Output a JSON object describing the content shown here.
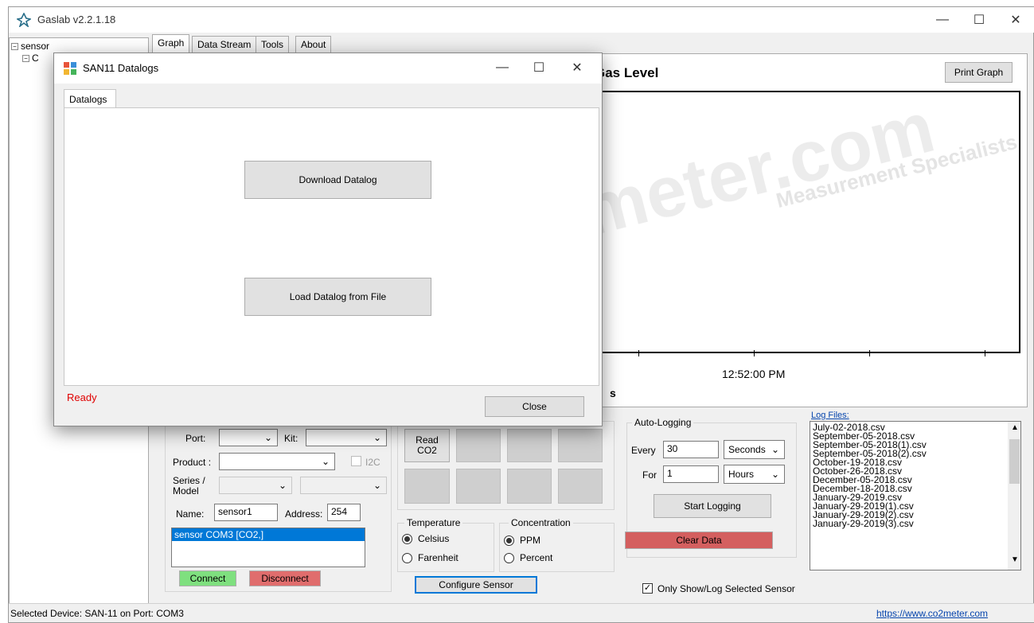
{
  "app": {
    "title": "Gaslab v2.2.1.18"
  },
  "tree": {
    "root": "sensor",
    "child": "C"
  },
  "tabs": [
    {
      "label": "Graph"
    },
    {
      "label": "Data Stream"
    },
    {
      "label": "Tools"
    },
    {
      "label": "About"
    }
  ],
  "graph": {
    "title": "Gas Level",
    "print_label": "Print Graph",
    "x_tick": "12:52:00 PM",
    "x_axis_fragment": "s",
    "watermark_big": "meter.com",
    "watermark_small": "Measurement Specialists"
  },
  "dialog": {
    "title": "SAN11 Datalogs",
    "tab": "Datalogs",
    "download_label": "Download Datalog",
    "load_label": "Load Datalog from File",
    "status": "Ready",
    "close_label": "Close"
  },
  "config": {
    "port_label": "Port:",
    "kit_label": "Kit:",
    "product_label": "Product :",
    "i2c_label": "I2C",
    "series_label_1": "Series /",
    "series_label_2": "Model",
    "name_label": "Name:",
    "name_value": "sensor1",
    "address_label": "Address:",
    "address_value": "254",
    "device_list": [
      "sensor COM3 [CO2,]"
    ],
    "connect_label": "Connect",
    "disconnect_label": "Disconnect"
  },
  "reading": {
    "read_label_1": "Read",
    "read_label_2": "CO2",
    "temperature_label": "Temperature",
    "celsius_label": "Celsius",
    "farenheit_label": "Farenheit",
    "concentration_label": "Concentration",
    "ppm_label": "PPM",
    "percent_label": "Percent",
    "configure_label": "Configure Sensor"
  },
  "logging": {
    "group_label": "Auto-Logging",
    "every_label": "Every",
    "every_value": "30",
    "every_unit": "Seconds",
    "for_label": "For",
    "for_value": "1",
    "for_unit": "Hours",
    "start_label": "Start Logging",
    "clear_label": "Clear Data",
    "only_show_label": "Only Show/Log Selected Sensor"
  },
  "log_files": {
    "header": "Log Files:",
    "items": [
      "July-02-2018.csv",
      "September-05-2018.csv",
      "September-05-2018(1).csv",
      "September-05-2018(2).csv",
      "October-19-2018.csv",
      "October-26-2018.csv",
      "December-05-2018.csv",
      "December-18-2018.csv",
      "January-29-2019.csv",
      "January-29-2019(1).csv",
      "January-29-2019(2).csv",
      "January-29-2019(3).csv"
    ]
  },
  "status": {
    "selected_device": "Selected Device: SAN-11 on Port: COM3",
    "url": "https://www.co2meter.com"
  },
  "colors": {
    "connect": "#7fe07f",
    "disconnect": "#e06d6d",
    "clear": "#d45f5f",
    "status_red": "#e00000",
    "selection": "#0078d7"
  }
}
